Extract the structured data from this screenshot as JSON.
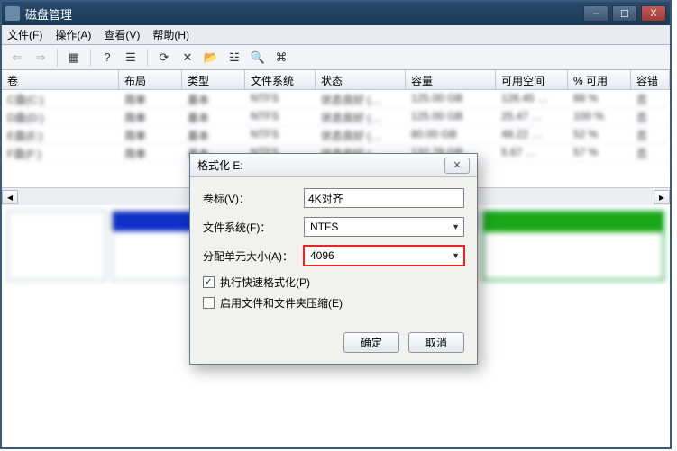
{
  "window": {
    "title": "磁盘管理",
    "minimize": "–",
    "maximize": "☐",
    "close": "X"
  },
  "menu": {
    "file": "文件(F)",
    "action": "操作(A)",
    "view": "查看(V)",
    "help": "帮助(H)"
  },
  "toolbar_icons": {
    "back": "⇐",
    "forward": "⇒",
    "up": "▦",
    "help": "?",
    "props": "☰",
    "refresh": "⟳",
    "delete": "✕",
    "open": "📂",
    "manage": "☳",
    "find": "🔍",
    "extra": "⌘"
  },
  "columns": {
    "volume": "卷",
    "layout": "布局",
    "type": "类型",
    "fs": "文件系统",
    "status": "状态",
    "capacity": "容量",
    "free": "可用空间",
    "pct": "% 可用",
    "tol": "容错"
  },
  "rows": [
    {
      "v": "C盘(C:)",
      "l": "简单",
      "t": "基本",
      "fs": "NTFS",
      "s": "状态良好 (…",
      "c": "125.00 GB",
      "f": "126.45 …",
      "p": "88 %",
      "tol": "否"
    },
    {
      "v": "D盘(D:)",
      "l": "简单",
      "t": "基本",
      "fs": "NTFS",
      "s": "状态良好 (…",
      "c": "125.00 GB",
      "f": "25.47 …",
      "p": "100 %",
      "tol": "否"
    },
    {
      "v": "E盘(E:)",
      "l": "简单",
      "t": "基本",
      "fs": "NTFS",
      "s": "状态良好 (…",
      "c": "80.00 GB",
      "f": "48.22 …",
      "p": "52 %",
      "tol": "否"
    },
    {
      "v": "F盘(F:)",
      "l": "简单",
      "t": "基本",
      "fs": "NTFS",
      "s": "状态良好 (…",
      "c": "132.78 GB",
      "f": "5.67 …",
      "p": "57 %",
      "tol": "否"
    }
  ],
  "dialog": {
    "title": "格式化 E:",
    "close": "✕",
    "label_name": "卷标(V)：",
    "value_name": "4K对齐",
    "label_fs": "文件系统(F)：",
    "value_fs": "NTFS",
    "label_au": "分配单元大小(A)：",
    "value_au": "4096",
    "quick_fmt": "执行快速格式化(P)",
    "compress": "启用文件和文件夹压缩(E)",
    "ok": "确定",
    "cancel": "取消"
  }
}
